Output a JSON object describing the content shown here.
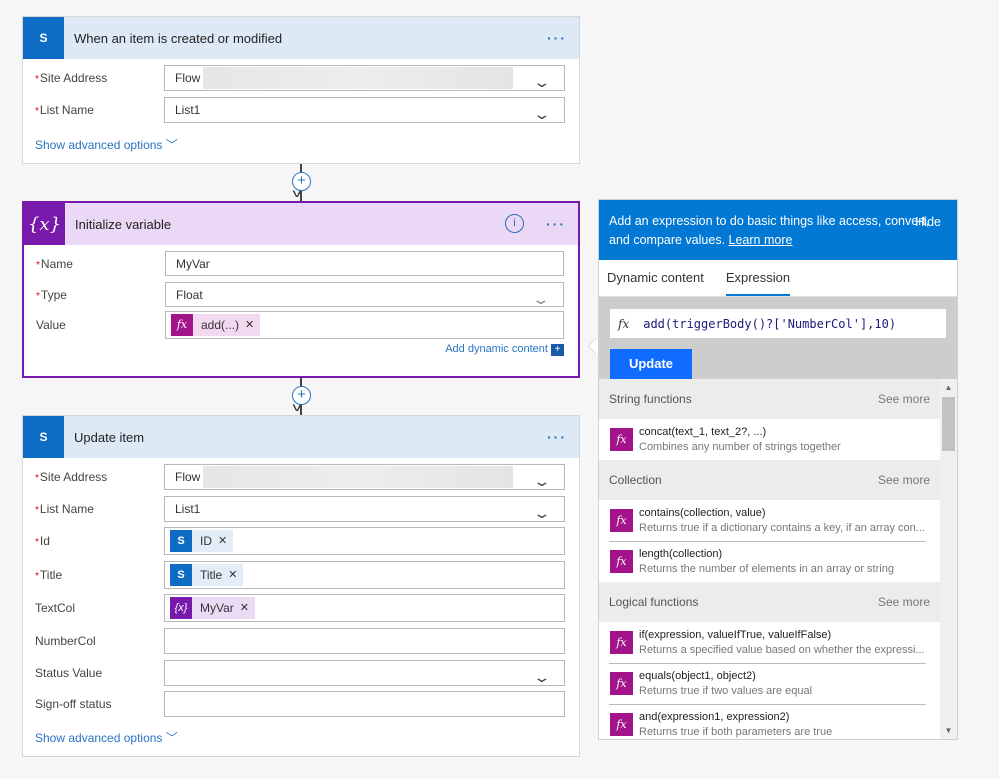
{
  "trigger": {
    "title": "When an item is created or modified",
    "fields": [
      {
        "label": "Site Address",
        "required": true,
        "value": "Flow -"
      },
      {
        "label": "List Name",
        "required": true,
        "value": "List1"
      }
    ],
    "advanced": "Show advanced options"
  },
  "init": {
    "title": "Initialize variable",
    "fields": {
      "name_label": "Name",
      "name_value": "MyVar",
      "type_label": "Type",
      "type_value": "Float",
      "value_label": "Value",
      "value_token": "add(...)"
    },
    "add_dynamic": "Add dynamic content"
  },
  "update": {
    "title": "Update item",
    "site_label": "Site Address",
    "site_value": "Flow -",
    "list_label": "List Name",
    "list_value": "List1",
    "id_label": "Id",
    "id_token": "ID",
    "title_label": "Title",
    "title_token": "Title",
    "textcol_label": "TextCol",
    "textcol_token": "MyVar",
    "numbercol_label": "NumberCol",
    "status_label": "Status Value",
    "signoff_label": "Sign-off status",
    "advanced": "Show advanced options"
  },
  "panel": {
    "intro": "Add an expression to do basic things like access, convert, and compare values.",
    "learn_more": "Learn more",
    "hide": "Hide",
    "tabs": [
      "Dynamic content",
      "Expression"
    ],
    "active_tab": "Expression",
    "expression": "add(triggerBody()?['NumberCol'],10)",
    "update": "Update",
    "sections": [
      {
        "title": "String functions",
        "see_more": "See more",
        "items": [
          {
            "name": "concat(text_1, text_2?, ...)",
            "desc": "Combines any number of strings together"
          }
        ]
      },
      {
        "title": "Collection",
        "see_more": "See more",
        "items": [
          {
            "name": "contains(collection, value)",
            "desc": "Returns true if a dictionary contains a key, if an array con..."
          },
          {
            "name": "length(collection)",
            "desc": "Returns the number of elements in an array or string"
          }
        ]
      },
      {
        "title": "Logical functions",
        "see_more": "See more",
        "items": [
          {
            "name": "if(expression, valueIfTrue, valueIfFalse)",
            "desc": "Returns a specified value based on whether the expressi..."
          },
          {
            "name": "equals(object1, object2)",
            "desc": "Returns true if two values are equal"
          },
          {
            "name": "and(expression1, expression2)",
            "desc": "Returns true if both parameters are true"
          }
        ]
      }
    ]
  },
  "colors": {
    "sharepoint": "#0e6cc4",
    "variable": "#7719aa",
    "function": "#a3138a",
    "accent": "#0078d4"
  }
}
